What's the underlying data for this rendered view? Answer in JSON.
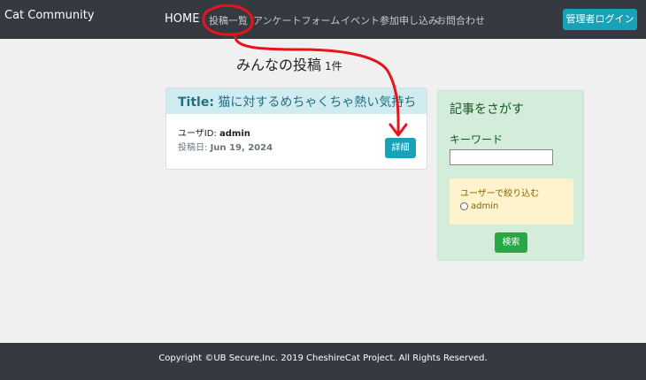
{
  "navbar": {
    "brand": "Cat Community",
    "home": "HOME",
    "links": [
      "投稿一覧",
      "アンケートフォーム",
      "イベント参加申し込み",
      "お問合わせ"
    ],
    "admin_login": "管理者ログイン"
  },
  "main": {
    "heading": "みんなの投稿",
    "count": "1件"
  },
  "post": {
    "title_label": "Title:",
    "title_text": "猫に対するめちゃくちゃ熱い気持ち",
    "user_label": "ユーザID:",
    "user_value": "admin",
    "date_label": "投稿日:",
    "date_value": "Jun 19, 2024",
    "detail_button": "詳細"
  },
  "search": {
    "title": "記事をさがす",
    "keyword_label": "キーワード",
    "keyword_value": "",
    "user_filter_label": "ユーザーで絞り込む",
    "user_options": [
      "admin"
    ],
    "search_button": "検索"
  },
  "footer": {
    "copyright": "Copyright ©UB Secure,Inc. 2019 CheshireCat Project. All Rights Reserved."
  },
  "colors": {
    "navbar": "#343a40",
    "accent": "#17a2b8",
    "success": "#28a745",
    "annotation": "#e8141c"
  }
}
